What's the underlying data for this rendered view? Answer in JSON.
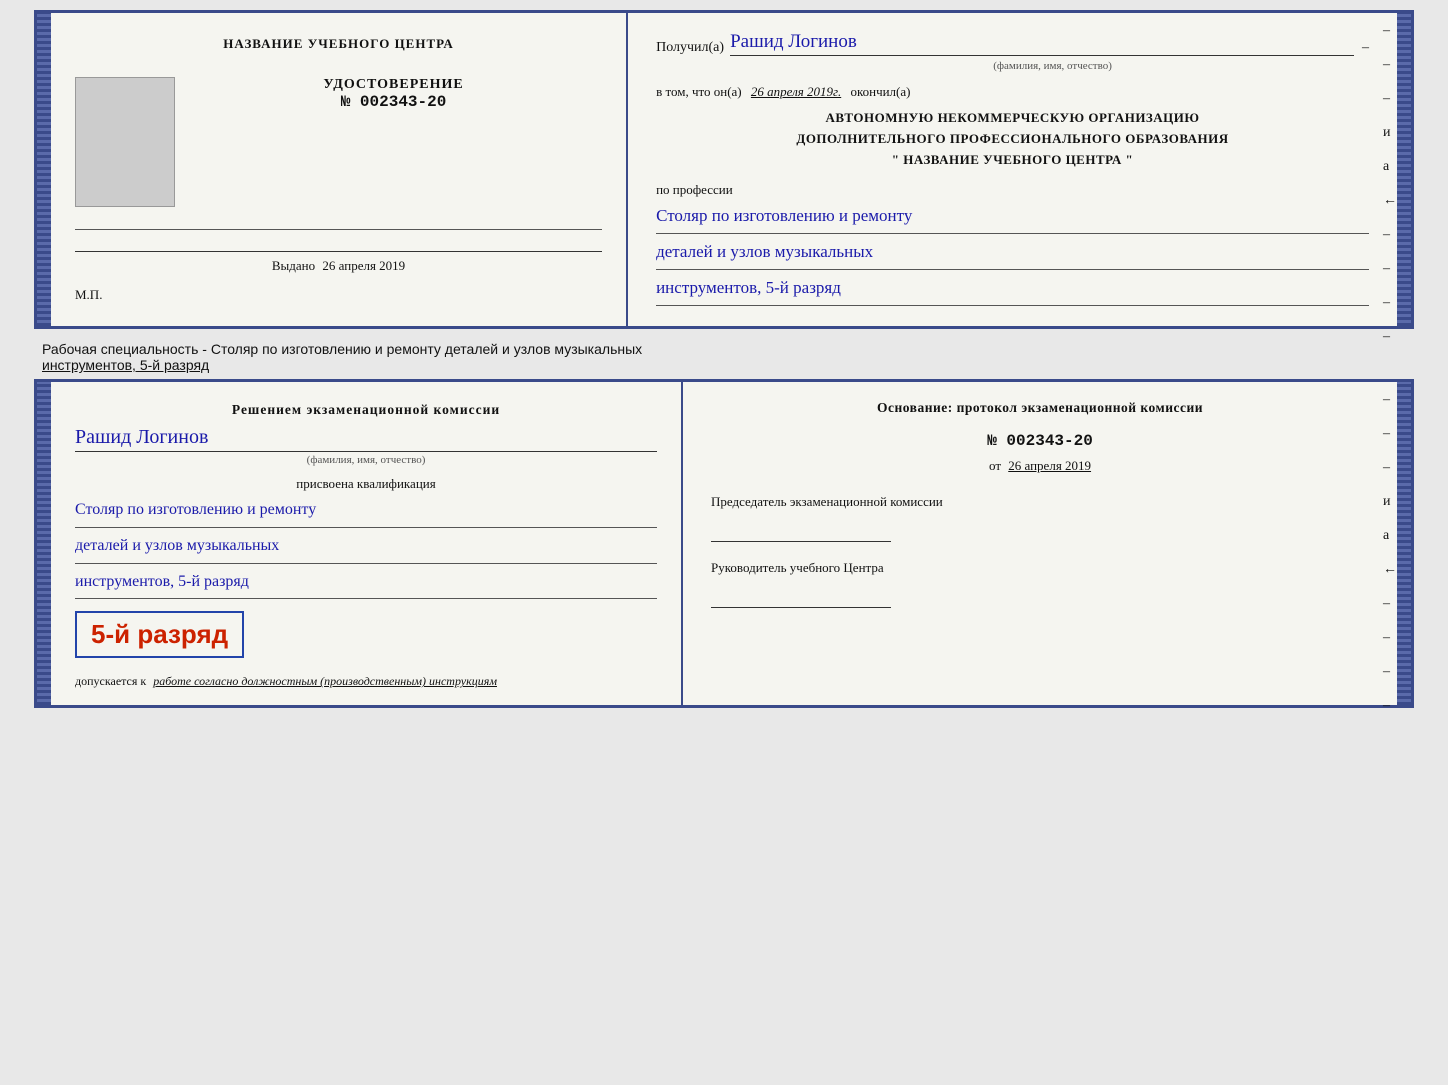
{
  "top_cert": {
    "left": {
      "center_title": "НАЗВАНИЕ УЧЕБНОГО ЦЕНТРА",
      "udost_title": "УДОСТОВЕРЕНИЕ",
      "udost_number": "№ 002343-20",
      "vydano_label": "Выдано",
      "vydano_date": "26 апреля 2019",
      "mp_label": "М.П."
    },
    "right": {
      "poluchil_label": "Получил(а)",
      "recipient_name": "Рашид Логинов",
      "fio_small": "(фамилия, имя, отчество)",
      "vtom_label": "в том, что он(а)",
      "vtom_date": "26 апреля 2019г.",
      "okonchil_label": "окончил(а)",
      "org_line1": "АВТОНОМНУЮ НЕКОММЕРЧЕСКУЮ ОРГАНИЗАЦИЮ",
      "org_line2": "ДОПОЛНИТЕЛЬНОГО ПРОФЕССИОНАЛЬНОГО ОБРАЗОВАНИЯ",
      "org_line3": "\"  НАЗВАНИЕ УЧЕБНОГО ЦЕНТРА  \"",
      "po_professii_label": "по профессии",
      "profession_line1": "Столяр по изготовлению и ремонту",
      "profession_line2": "деталей и узлов музыкальных",
      "profession_line3": "инструментов, 5-й разряд"
    }
  },
  "specialty_text": {
    "prefix": "Рабочая специальность - Столяр по изготовлению и ремонту деталей и узлов музыкальных",
    "suffix_underlined": "инструментов, 5-й разряд"
  },
  "inner_pages": {
    "left": {
      "resheniyem_title": "Решением экзаменационной комиссии",
      "recipient_name": "Рашид Логинов",
      "fio_small": "(фамилия, имя, отчество)",
      "prisvoyena_label": "присвоена квалификация",
      "profession_line1": "Столяр по изготовлению и ремонту",
      "profession_line2": "деталей и узлов музыкальных",
      "profession_line3": "инструментов, 5-й разряд",
      "razryad_badge": "5-й разряд",
      "dopuskaetsya_label": "допускается к",
      "dopuskaetsya_text": "работе согласно должностным (производственным) инструкциям"
    },
    "right": {
      "osnovanie_label": "Основание: протокол экзаменационной комиссии",
      "protocol_number": "№ 002343-20",
      "ot_label": "от",
      "ot_date": "26 апреля 2019",
      "predsedatel_label": "Председатель экзаменационной комиссии",
      "rukovoditel_label": "Руководитель учебного Центра"
    }
  },
  "right_edge_marks": [
    "-",
    "-",
    "-",
    "и",
    "а",
    "←",
    "-",
    "-",
    "-",
    "-"
  ],
  "accent_color": "#3a4a8a",
  "handwriting_color": "#1a1aaa",
  "badge_border_color": "#2244aa",
  "badge_text_color": "#cc2200"
}
